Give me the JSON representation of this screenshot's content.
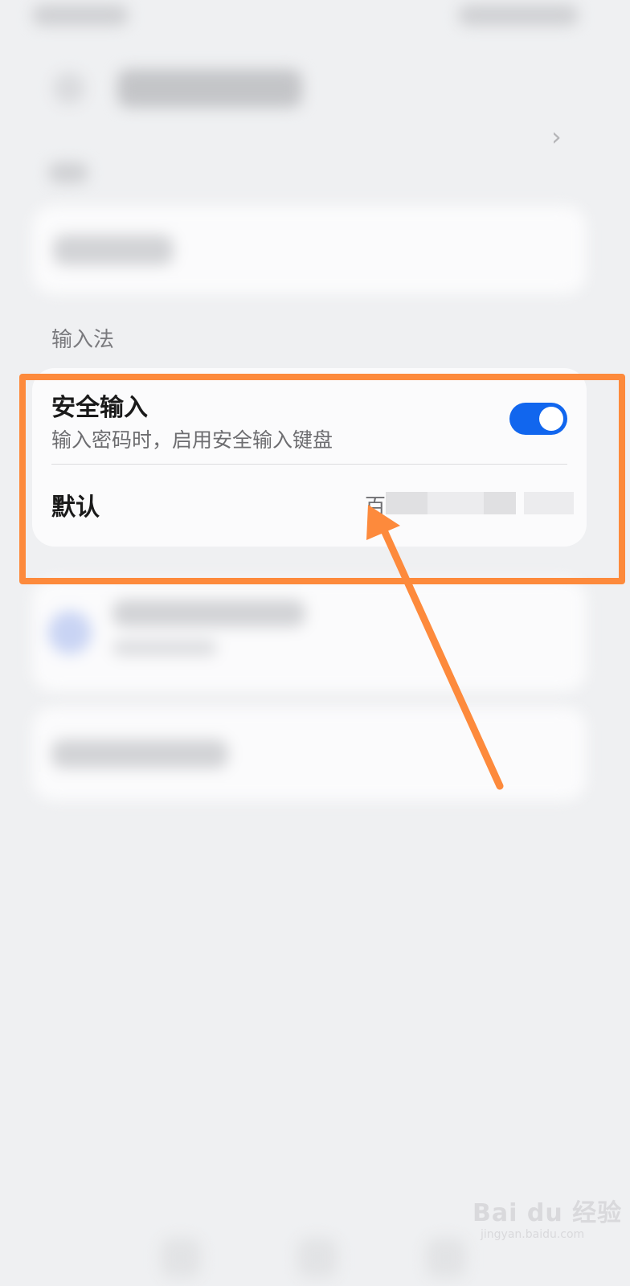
{
  "section": {
    "label": "输入法"
  },
  "secure_input": {
    "title": "安全输入",
    "subtitle": "输入密码时，启用安全输入键盘",
    "enabled": true
  },
  "default_ime": {
    "label": "默认",
    "value_visible": "百"
  },
  "annotation": {
    "color": "#fd8a3c"
  },
  "colors": {
    "toggle_on": "#1166ee",
    "background": "#eff0f2",
    "card": "#fbfbfc"
  },
  "watermark": {
    "main": "Bai du 经验",
    "sub": "jingyan.baidu.com"
  }
}
